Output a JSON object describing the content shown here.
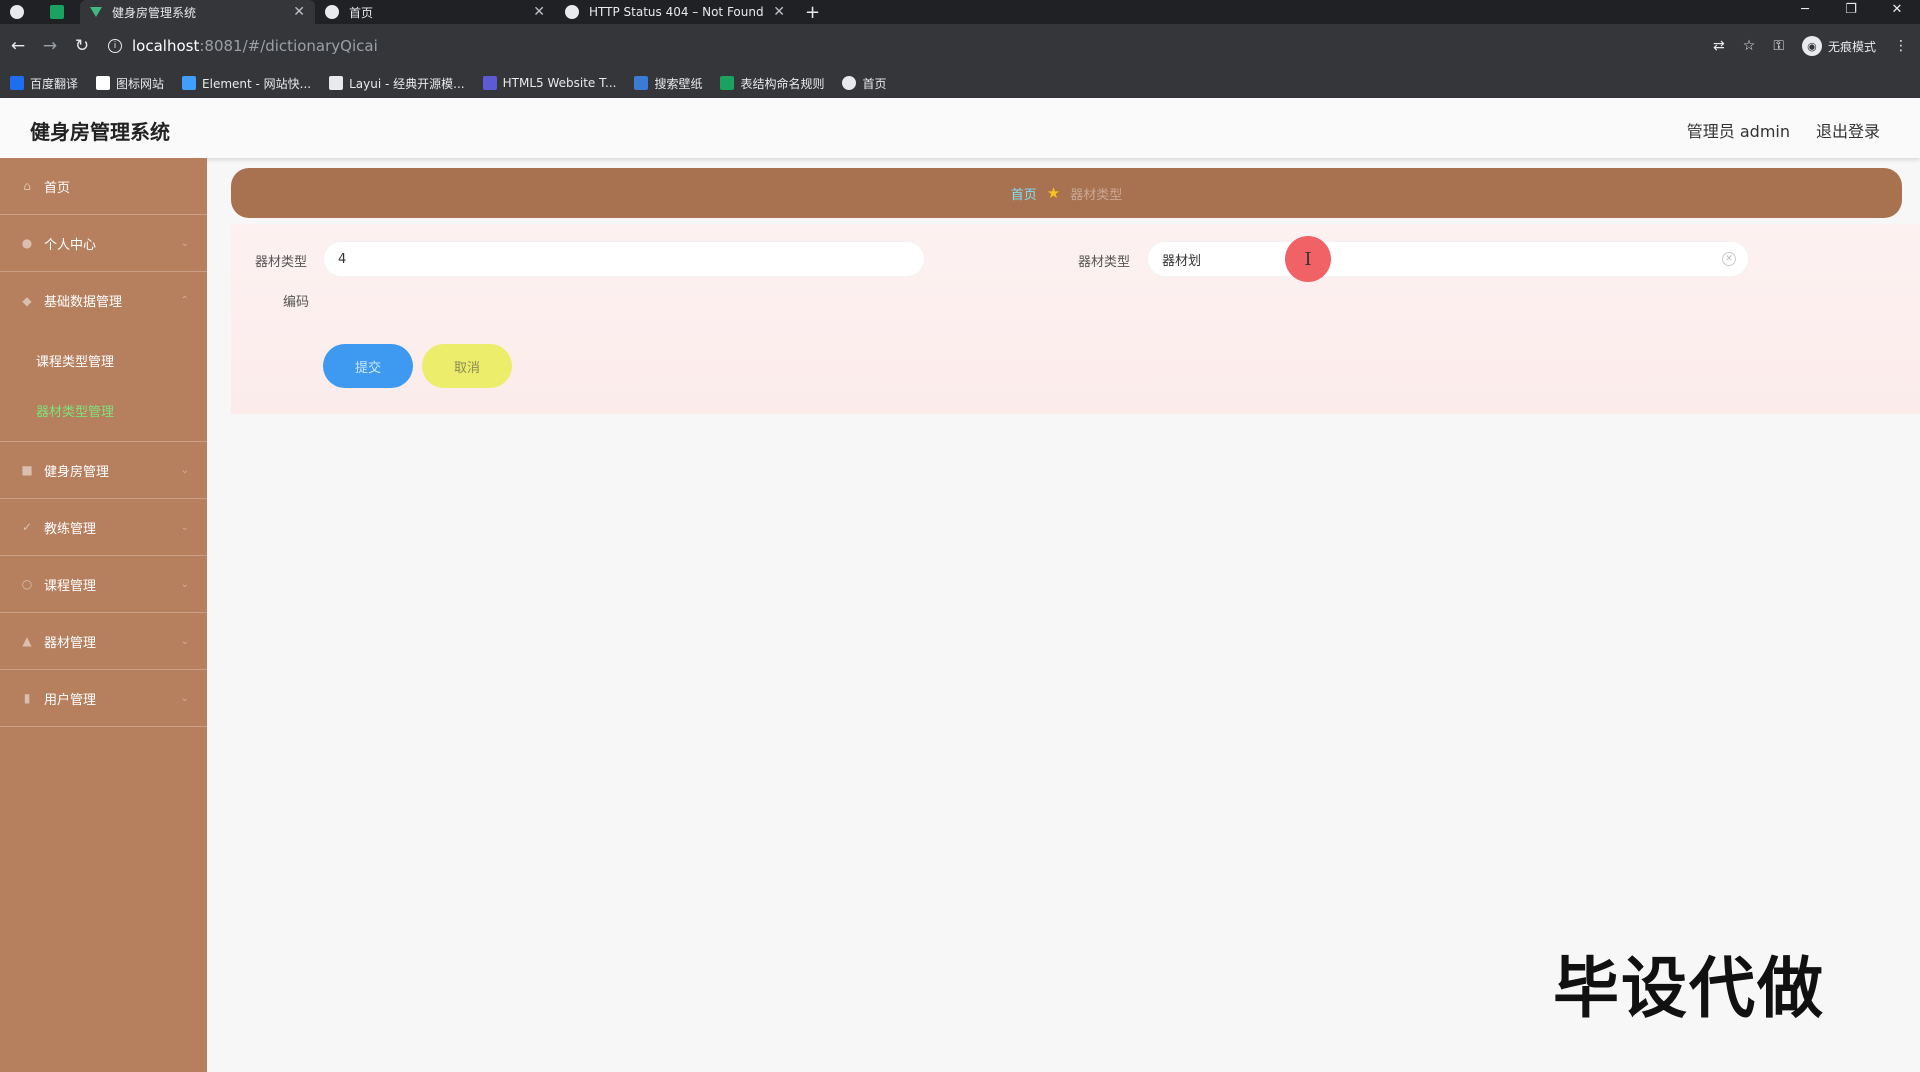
{
  "browser": {
    "tabs": [
      {
        "title": "健身房管理系统",
        "active": true
      },
      {
        "title": "首页",
        "active": false
      },
      {
        "title": "HTTP Status 404 – Not Found",
        "active": false
      }
    ],
    "new_tab": "+",
    "url_host": "localhost",
    "url_path": ":8081/#/dictionaryQicai",
    "incognito_label": "无痕模式",
    "bookmarks": [
      {
        "label": "百度翻译",
        "color": "#1e6ff0"
      },
      {
        "label": "图标网站",
        "color": "#ffffff"
      },
      {
        "label": "Element - 网站快...",
        "color": "#409eff"
      },
      {
        "label": "Layui - 经典开源模...",
        "color": "#e8eaed"
      },
      {
        "label": "HTML5 Website T...",
        "color": "#5b5bd6"
      },
      {
        "label": "搜索壁纸",
        "color": "#3a7bd5"
      },
      {
        "label": "表结构命名规则",
        "color": "#1aa260"
      },
      {
        "label": "首页",
        "color": "#e8eaed"
      }
    ]
  },
  "header": {
    "title": "健身房管理系统",
    "user": "管理员 admin",
    "logout": "退出登录"
  },
  "sidebar": {
    "items": [
      {
        "label": "首页",
        "icon": "home-icon"
      },
      {
        "label": "个人中心",
        "icon": "user-icon"
      },
      {
        "label": "基础数据管理",
        "icon": "data-icon"
      },
      {
        "label": "健身房管理",
        "icon": "gym-icon"
      },
      {
        "label": "教练管理",
        "icon": "coach-icon"
      },
      {
        "label": "课程管理",
        "icon": "course-icon"
      },
      {
        "label": "器材管理",
        "icon": "equipment-icon"
      },
      {
        "label": "用户管理",
        "icon": "users-icon"
      }
    ],
    "sub_items": [
      {
        "label": "课程类型管理",
        "active": false
      },
      {
        "label": "器材类型管理",
        "active": true
      }
    ]
  },
  "breadcrumb": {
    "home": "首页",
    "current": "器材类型"
  },
  "form": {
    "code_label": "器材类型",
    "code_label2": "编码",
    "code_value": "4",
    "name_label": "器材类型",
    "name_value": "器材划",
    "submit": "提交",
    "cancel": "取消"
  },
  "watermark": "毕设代做"
}
